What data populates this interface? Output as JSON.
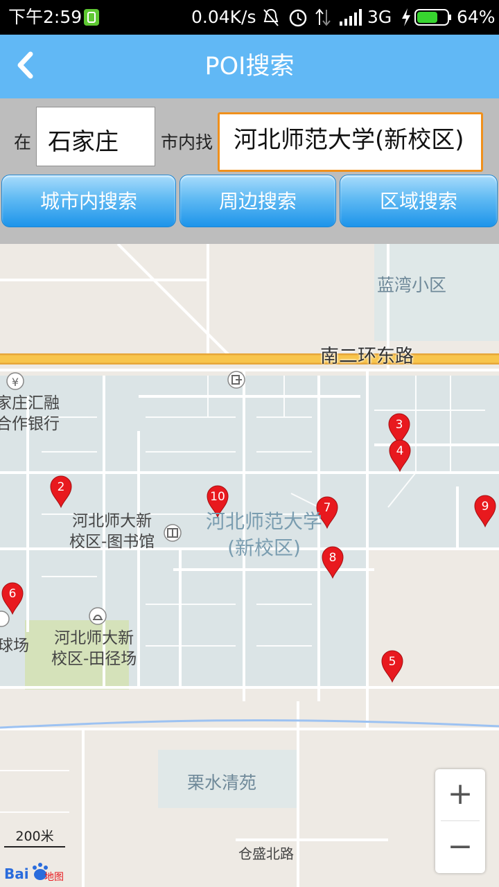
{
  "status_bar": {
    "time": "下午2:59",
    "network_speed": "0.04K/s",
    "network_type": "3G",
    "battery": "64%"
  },
  "header": {
    "title": "POI搜索",
    "back_icon": "chevron-left-icon"
  },
  "search": {
    "label_in": "在",
    "city": "石家庄",
    "label_find": "市内找",
    "keyword": "河北师范大学(新校区)",
    "buttons": [
      "城市内搜索",
      "周边搜索",
      "区域搜索"
    ]
  },
  "map": {
    "labels": {
      "lanwan": "蓝湾小区",
      "nanerhuan": "南二环东路",
      "bank_line1": "家庄汇融",
      "bank_line2": "合作银行",
      "library_line1": "河北师大新",
      "library_line2": "校区-图书馆",
      "campus_line1": "河北师范大学",
      "campus_line2": "(新校区)",
      "field_line1": "河北师大新",
      "field_line2": "校区-田径场",
      "ballfield": "球场",
      "lishui": "栗水清苑",
      "cangsheng": "仓盛北路"
    },
    "markers": [
      "2",
      "3",
      "4",
      "5",
      "6",
      "7",
      "8",
      "9",
      "10"
    ],
    "scale": "200米",
    "logo": "Baidu地图",
    "zoom_in": "+",
    "zoom_out": "−"
  },
  "colors": {
    "title_bar": "#61b8f5",
    "search_bg": "#bdbdbd",
    "keyword_border": "#f0901c",
    "marker": "#e8191e",
    "road_major": "#f8c54c"
  }
}
